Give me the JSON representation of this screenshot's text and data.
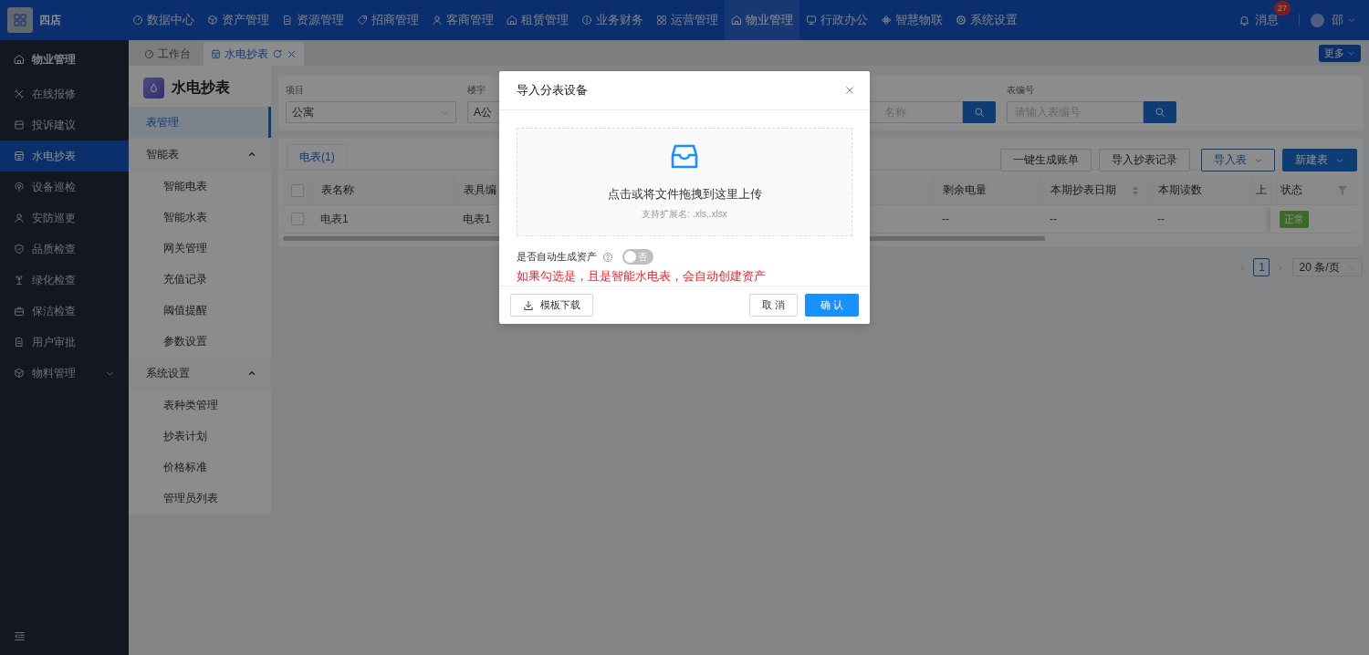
{
  "top_nav": {
    "brand": "四店",
    "items": [
      {
        "label": "数据中心",
        "selected": false
      },
      {
        "label": "资产管理",
        "selected": false
      },
      {
        "label": "资源管理",
        "selected": false
      },
      {
        "label": "招商管理",
        "selected": false
      },
      {
        "label": "客商管理",
        "selected": false
      },
      {
        "label": "租赁管理",
        "selected": false
      },
      {
        "label": "业务财务",
        "selected": false
      },
      {
        "label": "运营管理",
        "selected": false
      },
      {
        "label": "物业管理",
        "selected": true
      },
      {
        "label": "行政办公",
        "selected": false
      },
      {
        "label": "智慧物联",
        "selected": false
      },
      {
        "label": "系统设置",
        "selected": false
      }
    ],
    "messages": {
      "label": "消息",
      "badge": "27"
    },
    "user": {
      "name": "邵"
    }
  },
  "sidebar": {
    "header": "物业管理",
    "items": [
      {
        "label": "在线报修",
        "kind": "link",
        "selected": false
      },
      {
        "label": "投诉建议",
        "kind": "link",
        "selected": false
      },
      {
        "label": "水电抄表",
        "kind": "link",
        "selected": true
      },
      {
        "label": "设备巡检",
        "kind": "link",
        "selected": false
      },
      {
        "label": "安防巡更",
        "kind": "link",
        "selected": false
      },
      {
        "label": "品质检查",
        "kind": "link",
        "selected": false
      },
      {
        "label": "绿化检查",
        "kind": "link",
        "selected": false
      },
      {
        "label": "保洁检查",
        "kind": "link",
        "selected": false
      },
      {
        "label": "用户审批",
        "kind": "link",
        "selected": false
      },
      {
        "label": "物料管理",
        "kind": "group",
        "selected": false,
        "expanded": false
      }
    ]
  },
  "page_tabs": [
    {
      "label": "工作台",
      "selected": false
    },
    {
      "label": "水电抄表",
      "selected": true
    }
  ],
  "more_button": "更多",
  "submenu": {
    "title": "水电抄表",
    "items": [
      {
        "label": "表管理",
        "kind": "link",
        "selected": true
      },
      {
        "label": "智能表",
        "kind": "group",
        "expanded": true,
        "children": [
          {
            "label": "智能电表",
            "selected": false
          },
          {
            "label": "智能水表",
            "selected": false
          },
          {
            "label": "网关管理",
            "selected": false
          },
          {
            "label": "充值记录",
            "selected": false
          },
          {
            "label": "阈值提醒",
            "selected": false
          },
          {
            "label": "参数设置",
            "selected": false
          }
        ]
      },
      {
        "label": "系统设置",
        "kind": "group",
        "expanded": true,
        "children": [
          {
            "label": "表种类管理",
            "selected": false
          },
          {
            "label": "抄表计划",
            "selected": false
          },
          {
            "label": "价格标准",
            "selected": false
          },
          {
            "label": "管理员列表",
            "selected": false
          }
        ]
      }
    ]
  },
  "filters": [
    {
      "kind": "select",
      "label": "项目",
      "value": "公寓"
    },
    {
      "kind": "select",
      "label": "楼宇",
      "value": "A公"
    },
    {
      "kind": "search",
      "placeholder": "名称"
    },
    {
      "kind": "search",
      "label": "表编号",
      "placeholder": "请输入表编号"
    }
  ],
  "meter_tabs": [
    {
      "label": "电表(1)",
      "selected": true
    }
  ],
  "actions": [
    {
      "label": "一键生成账单",
      "kind": "default"
    },
    {
      "label": "导入抄表记录",
      "kind": "default"
    },
    {
      "label": "导入表",
      "kind": "outline-dropdown"
    },
    {
      "label": "新建表",
      "kind": "primary-dropdown"
    }
  ],
  "table": {
    "header_checked": false,
    "columns": {
      "table_name": "表名称",
      "meter_no": "表具编",
      "remaining": "剩余电量",
      "reading_date": "本期抄表日期",
      "reading": "本期读数",
      "previous": "上",
      "status": "状态"
    },
    "rows": [
      {
        "checked": false,
        "table_name": "电表1",
        "meter_no": "电表1",
        "remaining": "--",
        "reading_date": "--",
        "reading": "--",
        "status": "正常"
      }
    ]
  },
  "pagination": {
    "pages": [
      {
        "label": "1",
        "selected": true
      }
    ],
    "page_size": "20 条/页"
  },
  "modal": {
    "title": "导入分表设备",
    "upload": {
      "text": "点击或将文件拖拽到这里上传",
      "hint": "支持扩展名: .xls,.xlsx"
    },
    "switch": {
      "label": "是否自动生成资产",
      "on": false,
      "state_text": "否"
    },
    "warning": "如果勾选是，且是智能水电表，会自动创建资产",
    "buttons": [
      {
        "label": "模板下载",
        "kind": "download"
      },
      {
        "label": "取 消",
        "kind": "default"
      },
      {
        "label": "确 认",
        "kind": "primary"
      }
    ]
  }
}
